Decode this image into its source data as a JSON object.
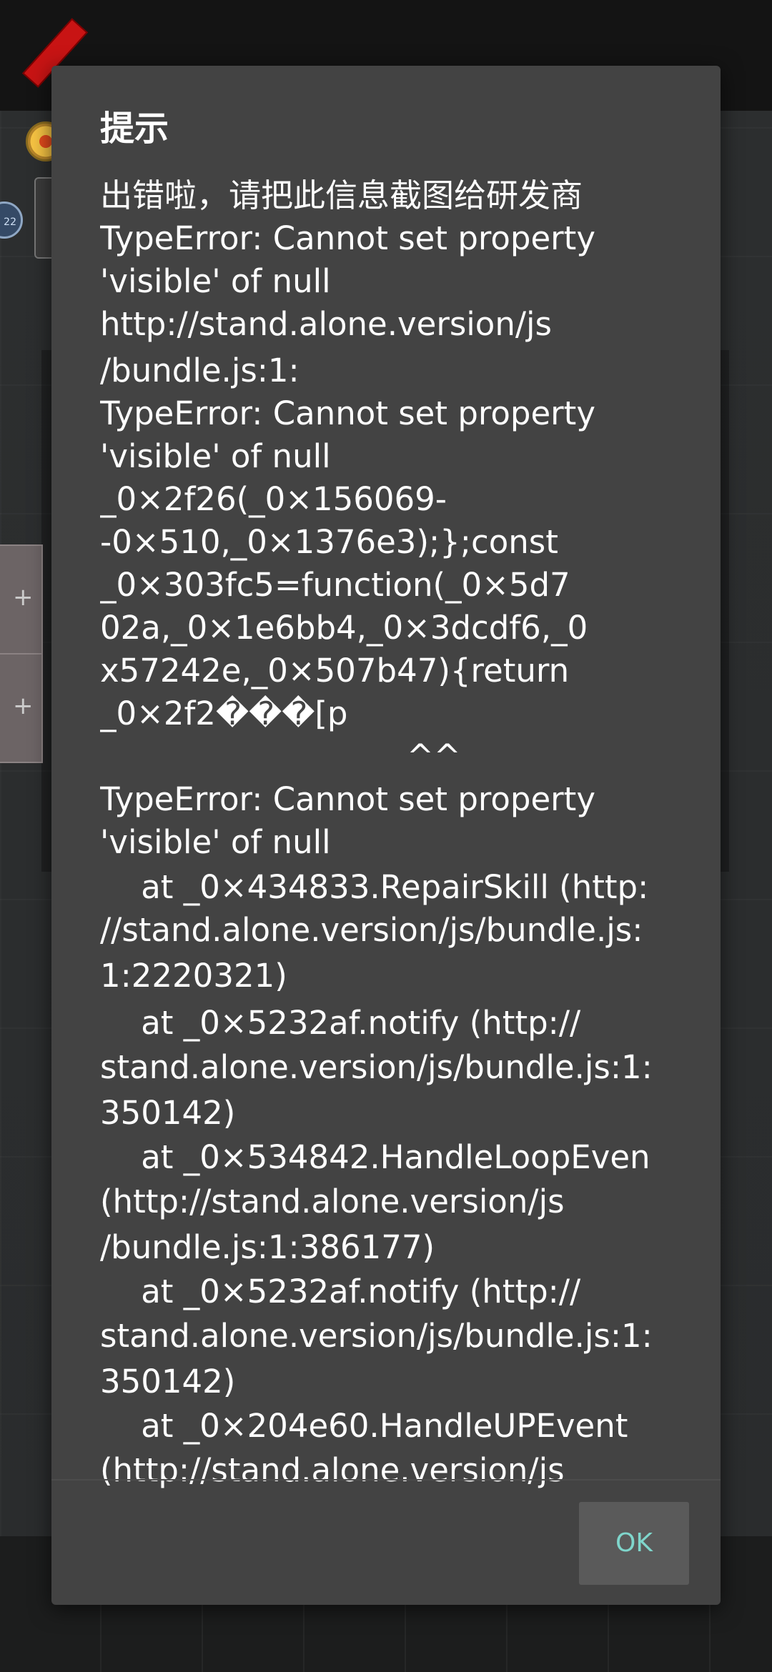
{
  "dialog": {
    "title": "提示",
    "message_lines": [
      "出错啦，请把此信息截图给研发商",
      "TypeError: Cannot set property",
      "'visible' of null",
      "http://stand.alone.version/js",
      "/bundle.js:1:",
      "TypeError: Cannot set property",
      "'visible' of null",
      "_0×2f26(_0×156069-",
      "-0×510,_0×1376e3);};const",
      "_0×303fc5=function(_0×5d7",
      "02a,_0×1e6bb4,_0×3dcdf6,_0",
      "x57242e,_0×507b47){return",
      "_0×2f2���[p",
      "                              ^^",
      "TypeError: Cannot set property",
      "'visible' of null",
      "    at _0×434833.RepairSkill (http:",
      "//stand.alone.version/js/bundle.js:",
      "1:2220321)",
      "    at _0×5232af.notify (http://",
      "stand.alone.version/js/bundle.js:1:",
      "350142)",
      "    at _0×534842.HandleLoopEven",
      "(http://stand.alone.version/js",
      "/bundle.js:1:386177)",
      "    at _0×5232af.notify (http://",
      "stand.alone.version/js/bundle.js:1:",
      "350142)",
      "    at _0×204e60.HandleUPEvent",
      "(http://stand.alone.version/js"
    ],
    "ok_label": "OK"
  },
  "background": {
    "round_badge_text": "22",
    "side_panel_symbol": "+"
  },
  "colors": {
    "dialog_bg": "#434343",
    "accent": "#7fd6cc",
    "button_bg": "#5a5a5a"
  }
}
